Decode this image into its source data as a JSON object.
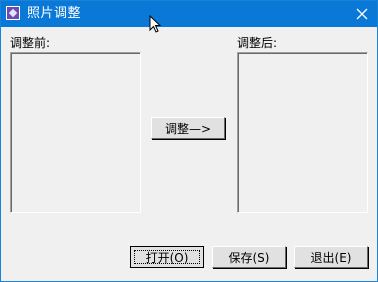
{
  "window": {
    "title": "照片调整"
  },
  "labels": {
    "before": "调整前:",
    "after": "调整后:"
  },
  "buttons": {
    "adjust": "调整—>",
    "open": "打开(O)",
    "save": "保存(S)",
    "exit": "退出(E)"
  },
  "icons": {
    "app": "photo-app-icon",
    "close": "close-icon",
    "cursor": "mouse-cursor-icon"
  },
  "colors": {
    "titlebar": "#0a78d7",
    "window_bg": "#f0f0f0"
  }
}
